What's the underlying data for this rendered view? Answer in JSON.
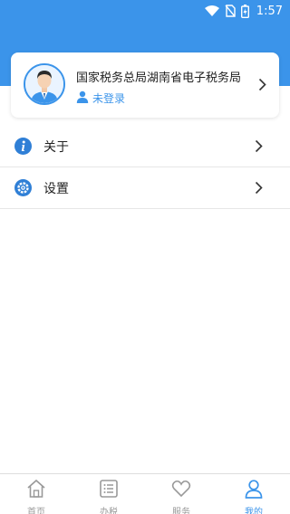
{
  "status_bar": {
    "time": "1:57"
  },
  "profile": {
    "organization": "国家税务总局湖南省电子税务局",
    "login_status": "未登录"
  },
  "menu": {
    "items": [
      {
        "label": "关于",
        "icon": "info-icon"
      },
      {
        "label": "设置",
        "icon": "settings-icon"
      }
    ]
  },
  "tabbar": {
    "tabs": [
      {
        "label": "首页",
        "icon": "home-icon",
        "active": false
      },
      {
        "label": "办税",
        "icon": "list-icon",
        "active": false
      },
      {
        "label": "服务",
        "icon": "heart-icon",
        "active": false
      },
      {
        "label": "我的",
        "icon": "user-icon",
        "active": true
      }
    ]
  },
  "colors": {
    "accent": "#3b94ea",
    "inactive": "#999999"
  }
}
